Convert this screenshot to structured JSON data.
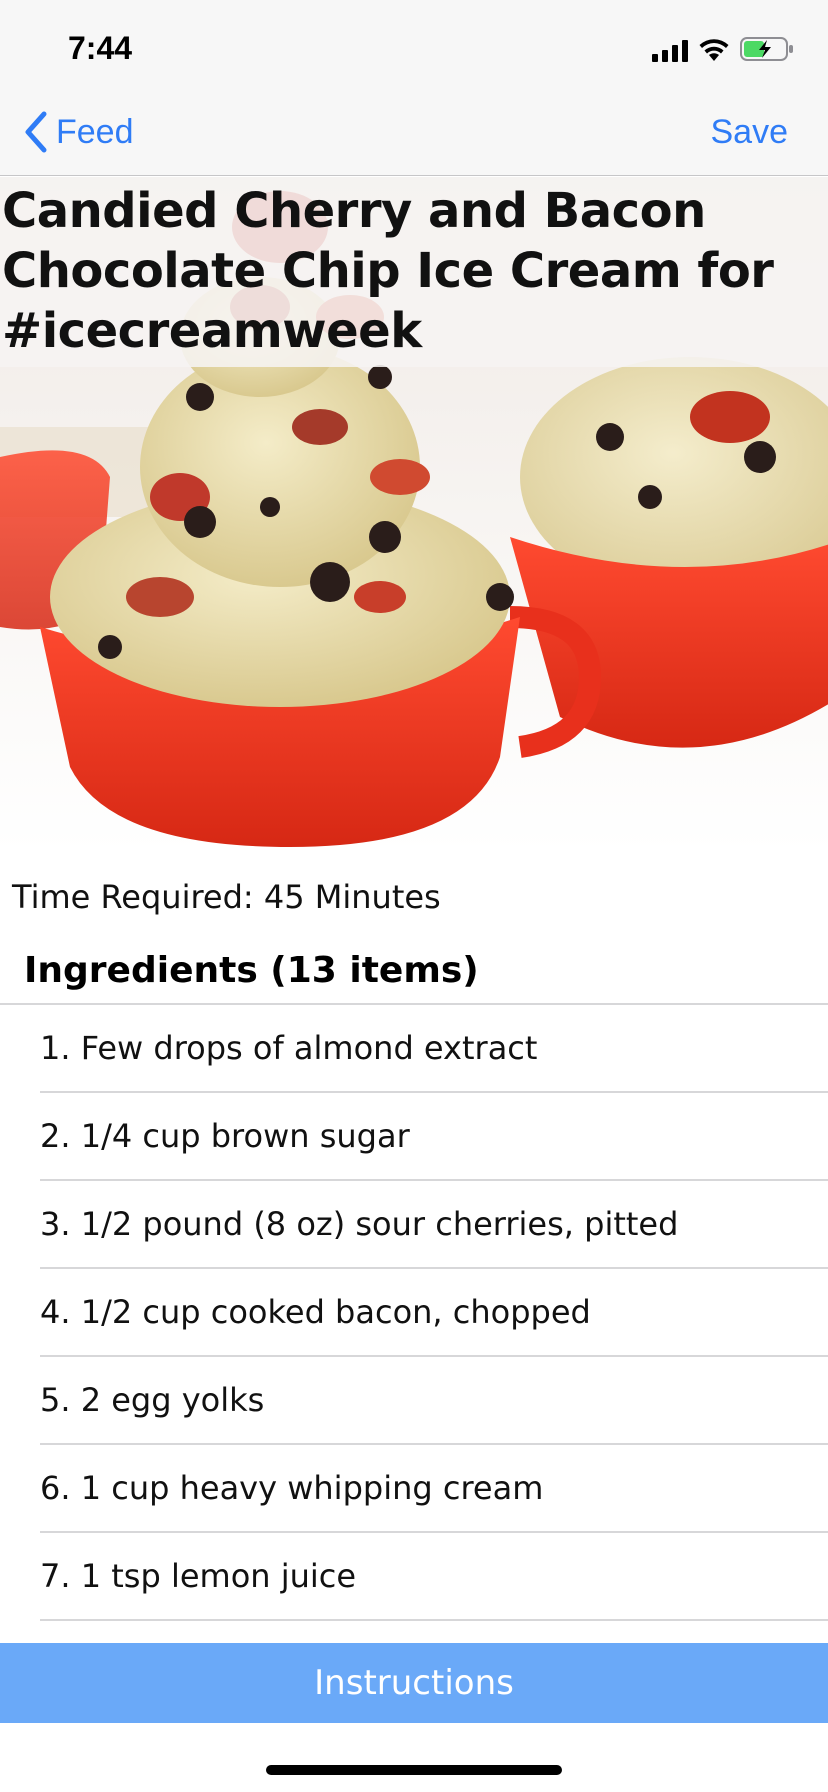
{
  "status_bar": {
    "time": "7:44",
    "icons": [
      "signal-icon",
      "wifi-icon",
      "battery-charging-icon"
    ],
    "battery_color": "#4cd964"
  },
  "nav": {
    "back_label": "Feed",
    "save_label": "Save",
    "accent_color": "#2f7cf6"
  },
  "recipe": {
    "title": "Candied Cherry and Bacon Chocolate Chip Ice Cream for #icecreamweek",
    "time_required": "Time Required: 45 Minutes",
    "ingredients_heading": "Ingredients (13 items)",
    "ingredients": [
      "1. Few drops of almond extract",
      "2. 1/4 cup brown sugar",
      "3. 1/2 pound (8 oz) sour cherries, pitted",
      "4. 1/2 cup cooked bacon, chopped",
      "5. 2 egg yolks",
      "6. 1 cup heavy whipping cream",
      "7. 1 tsp lemon juice"
    ]
  },
  "footer": {
    "instructions_label": "Instructions",
    "button_color": "#6aa9f8"
  }
}
